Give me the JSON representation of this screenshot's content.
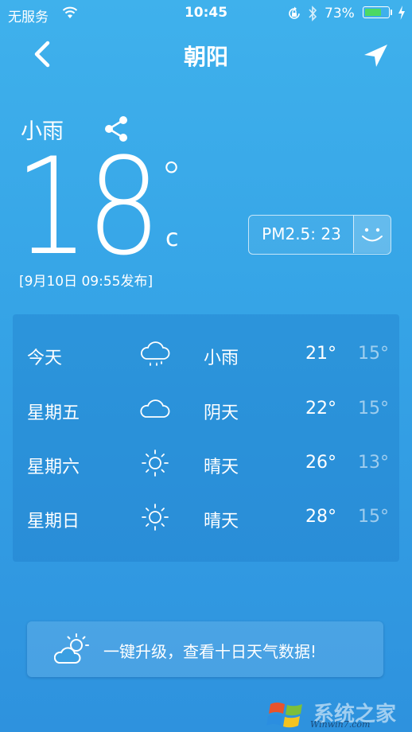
{
  "status_bar": {
    "carrier": "无服务",
    "time": "10:45",
    "battery_pct": "73%",
    "battery_level": 0.73,
    "battery_color": "#4cd964",
    "icons": [
      "wifi-icon",
      "rotation-lock-icon",
      "bluetooth-icon",
      "battery-icon",
      "charging-bolt-icon"
    ]
  },
  "nav": {
    "city": "朝阳",
    "back_icon": "chevron-left-icon",
    "locate_icon": "location-arrow-icon"
  },
  "current": {
    "condition": "小雨",
    "share_icon": "share-icon",
    "temperature": "18",
    "degree_symbol": "°",
    "unit": "c",
    "published": "[9月10日 09:55发布]",
    "pm25_label": "PM2.5: 23",
    "pm25_icon": "smiley-face-icon"
  },
  "forecast": [
    {
      "day": "今天",
      "icon": "rain-cloud-icon",
      "condition": "小雨",
      "high": "21°",
      "low": "15°"
    },
    {
      "day": "星期五",
      "icon": "cloud-icon",
      "condition": "阴天",
      "high": "22°",
      "low": "15°"
    },
    {
      "day": "星期六",
      "icon": "sun-icon",
      "condition": "晴天",
      "high": "26°",
      "low": "13°"
    },
    {
      "day": "星期日",
      "icon": "sun-icon",
      "condition": "晴天",
      "high": "28°",
      "low": "15°"
    }
  ],
  "upgrade": {
    "icon": "partly-cloudy-icon",
    "text": "一键升级，查看十日天气数据!"
  },
  "watermark": {
    "title": "系统之家",
    "url": "Winwin7.com",
    "logo_icon": "windows-logo-icon"
  },
  "colors": {
    "background_top": "#3fb1ec",
    "background_bottom": "#2e92de"
  }
}
